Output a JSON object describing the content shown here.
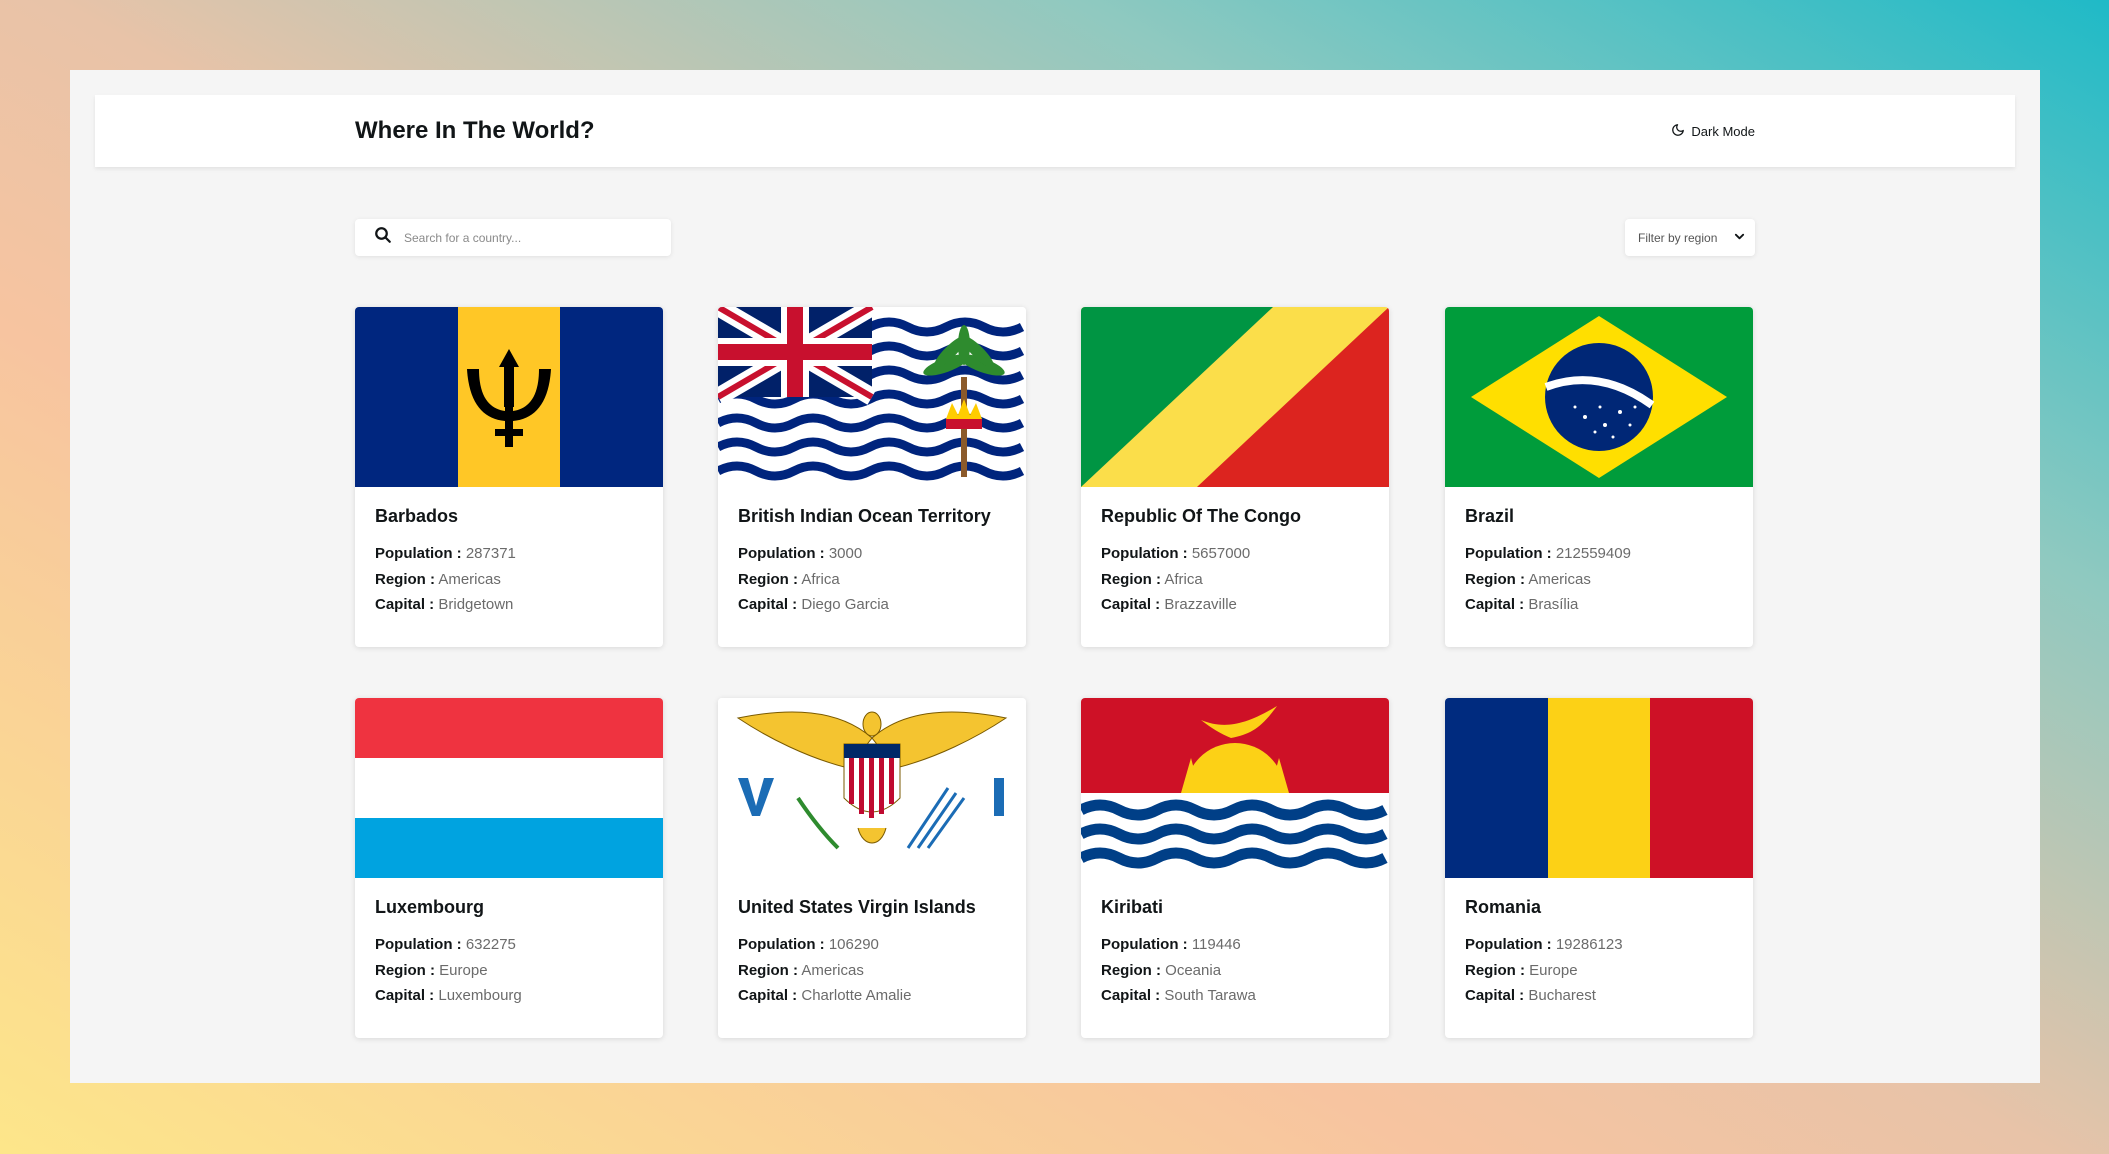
{
  "header": {
    "title": "Where In The World?",
    "theme_toggle_label": "Dark Mode"
  },
  "search": {
    "placeholder": "Search for a country..."
  },
  "filter": {
    "label": "Filter by region"
  },
  "labels": {
    "population": "Population :",
    "region": "Region :",
    "capital": "Capital :"
  },
  "countries": [
    {
      "name": "Barbados",
      "population": "287371",
      "region": "Americas",
      "capital": "Bridgetown",
      "flag": "barbados-flag"
    },
    {
      "name": "British Indian Ocean Territory",
      "population": "3000",
      "region": "Africa",
      "capital": "Diego Garcia",
      "flag": "british-indian-ocean-territory-flag"
    },
    {
      "name": "Republic Of The Congo",
      "population": "5657000",
      "region": "Africa",
      "capital": "Brazzaville",
      "flag": "republic-of-the-congo-flag"
    },
    {
      "name": "Brazil",
      "population": "212559409",
      "region": "Americas",
      "capital": "Brasília",
      "flag": "brazil-flag"
    },
    {
      "name": "Luxembourg",
      "population": "632275",
      "region": "Europe",
      "capital": "Luxembourg",
      "flag": "luxembourg-flag"
    },
    {
      "name": "United States Virgin Islands",
      "population": "106290",
      "region": "Americas",
      "capital": "Charlotte Amalie",
      "flag": "us-virgin-islands-flag"
    },
    {
      "name": "Kiribati",
      "population": "119446",
      "region": "Oceania",
      "capital": "South Tarawa",
      "flag": "kiribati-flag"
    },
    {
      "name": "Romania",
      "population": "19286123",
      "region": "Europe",
      "capital": "Bucharest",
      "flag": "romania-flag"
    }
  ]
}
